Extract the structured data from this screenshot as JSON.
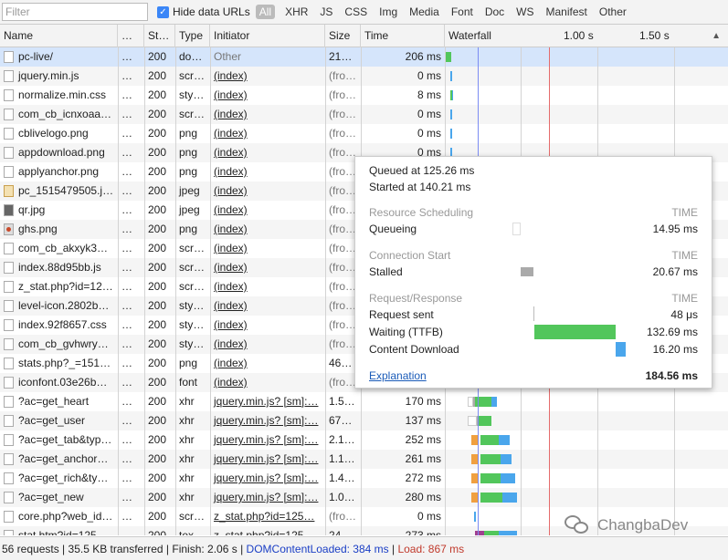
{
  "filter": {
    "placeholder": "Filter"
  },
  "hide_data_urls": {
    "label": "Hide data URLs",
    "checked": true
  },
  "type_filters": [
    "All",
    "XHR",
    "JS",
    "CSS",
    "Img",
    "Media",
    "Font",
    "Doc",
    "WS",
    "Manifest",
    "Other"
  ],
  "columns": {
    "name": "Name",
    "dots": "…",
    "status": "St…",
    "type": "Type",
    "initiator": "Initiator",
    "size": "Size",
    "time": "Time",
    "waterfall": "Waterfall"
  },
  "waterfall_ticks": [
    "1.00 s",
    "1.50 s"
  ],
  "rows": [
    {
      "name": "pc-live/",
      "dots": "…",
      "status": "200",
      "type": "do…",
      "initiator": "Other",
      "size": "21…",
      "time": "206 ms",
      "icon": "document-icon"
    },
    {
      "name": "jquery.min.js",
      "dots": "…",
      "status": "200",
      "type": "scr…",
      "initiator": "(index)",
      "size": "(fro…",
      "time": "0 ms",
      "icon": "document-icon"
    },
    {
      "name": "normalize.min.css",
      "dots": "…",
      "status": "200",
      "type": "sty…",
      "initiator": "(index)",
      "size": "(fro…",
      "time": "8 ms",
      "icon": "document-icon"
    },
    {
      "name": "com_cb_icnxoaa…",
      "dots": "…",
      "status": "200",
      "type": "scr…",
      "initiator": "(index)",
      "size": "(fro…",
      "time": "0 ms",
      "icon": "document-icon"
    },
    {
      "name": "cblivelogo.png",
      "dots": "…",
      "status": "200",
      "type": "png",
      "initiator": "(index)",
      "size": "(fro…",
      "time": "0 ms",
      "icon": "document-icon"
    },
    {
      "name": "appdownload.png",
      "dots": "…",
      "status": "200",
      "type": "png",
      "initiator": "(index)",
      "size": "(fro…",
      "time": "0 ms",
      "icon": "document-icon"
    },
    {
      "name": "applyanchor.png",
      "dots": "…",
      "status": "200",
      "type": "png",
      "initiator": "(index)",
      "size": "(fro…",
      "time": "",
      "icon": "document-icon"
    },
    {
      "name": "pc_1515479505.j…",
      "dots": "…",
      "status": "200",
      "type": "jpeg",
      "initiator": "(index)",
      "size": "(fro…",
      "time": "",
      "icon": "jpeg-icon"
    },
    {
      "name": "qr.jpg",
      "dots": "…",
      "status": "200",
      "type": "jpeg",
      "initiator": "(index)",
      "size": "(fro…",
      "time": "",
      "icon": "qr-image-icon"
    },
    {
      "name": "ghs.png",
      "dots": "…",
      "status": "200",
      "type": "png",
      "initiator": "(index)",
      "size": "(fro…",
      "time": "",
      "icon": "image-icon"
    },
    {
      "name": "com_cb_akxyk3…",
      "dots": "…",
      "status": "200",
      "type": "scr…",
      "initiator": "(index)",
      "size": "(fro…",
      "time": "",
      "icon": "document-icon"
    },
    {
      "name": "index.88d95bb.js",
      "dots": "…",
      "status": "200",
      "type": "scr…",
      "initiator": "(index)",
      "size": "(fro…",
      "time": "",
      "icon": "document-icon"
    },
    {
      "name": "z_stat.php?id=12…",
      "dots": "…",
      "status": "200",
      "type": "scr…",
      "initiator": "(index)",
      "size": "(fro…",
      "time": "",
      "icon": "document-icon"
    },
    {
      "name": "level-icon.2802b…",
      "dots": "…",
      "status": "200",
      "type": "sty…",
      "initiator": "(index)",
      "size": "(fro…",
      "time": "",
      "icon": "document-icon"
    },
    {
      "name": "index.92f8657.css",
      "dots": "…",
      "status": "200",
      "type": "sty…",
      "initiator": "(index)",
      "size": "(fro…",
      "time": "",
      "icon": "document-icon"
    },
    {
      "name": "com_cb_gvhwry…",
      "dots": "…",
      "status": "200",
      "type": "sty…",
      "initiator": "(index)",
      "size": "(fro…",
      "time": "",
      "icon": "document-icon"
    },
    {
      "name": "stats.php?_=151…",
      "dots": "…",
      "status": "200",
      "type": "png",
      "initiator": "(index)",
      "size": "46…",
      "time": "",
      "icon": "document-icon"
    },
    {
      "name": "iconfont.03e26b…",
      "dots": "…",
      "status": "200",
      "type": "font",
      "initiator": "(index)",
      "size": "(fro…",
      "time": "",
      "icon": "document-icon"
    },
    {
      "name": "?ac=get_heart",
      "dots": "…",
      "status": "200",
      "type": "xhr",
      "initiator": "jquery.min.js? [sm]:…",
      "size": "1.5…",
      "time": "170 ms",
      "icon": "document-icon"
    },
    {
      "name": "?ac=get_user",
      "dots": "…",
      "status": "200",
      "type": "xhr",
      "initiator": "jquery.min.js? [sm]:…",
      "size": "67…",
      "time": "137 ms",
      "icon": "document-icon"
    },
    {
      "name": "?ac=get_tab&typ…",
      "dots": "…",
      "status": "200",
      "type": "xhr",
      "initiator": "jquery.min.js? [sm]:…",
      "size": "2.1…",
      "time": "252 ms",
      "icon": "document-icon"
    },
    {
      "name": "?ac=get_anchor…",
      "dots": "…",
      "status": "200",
      "type": "xhr",
      "initiator": "jquery.min.js? [sm]:…",
      "size": "1.1…",
      "time": "261 ms",
      "icon": "document-icon"
    },
    {
      "name": "?ac=get_rich&ty…",
      "dots": "…",
      "status": "200",
      "type": "xhr",
      "initiator": "jquery.min.js? [sm]:…",
      "size": "1.4…",
      "time": "272 ms",
      "icon": "document-icon"
    },
    {
      "name": "?ac=get_new",
      "dots": "…",
      "status": "200",
      "type": "xhr",
      "initiator": "jquery.min.js? [sm]:…",
      "size": "1.0…",
      "time": "280 ms",
      "icon": "document-icon"
    },
    {
      "name": "core.php?web_id…",
      "dots": "…",
      "status": "200",
      "type": "scr…",
      "initiator": "z_stat.php?id=125…",
      "size": "(fro…",
      "time": "0 ms",
      "icon": "document-icon"
    },
    {
      "name": "stat.htm?id=125…",
      "dots": "…",
      "status": "200",
      "type": "tex…",
      "initiator": "z_stat.php?id=125…",
      "size": "24…",
      "time": "273 ms",
      "icon": "document-icon"
    }
  ],
  "tooltip": {
    "queued": "Queued at 125.26 ms",
    "started": "Started at 140.21 ms",
    "sections": [
      {
        "title": "Resource Scheduling",
        "time_label": "TIME",
        "items": [
          {
            "label": "Queueing",
            "value": "14.95 ms"
          }
        ]
      },
      {
        "title": "Connection Start",
        "time_label": "TIME",
        "items": [
          {
            "label": "Stalled",
            "value": "20.67 ms"
          }
        ]
      },
      {
        "title": "Request/Response",
        "time_label": "TIME",
        "items": [
          {
            "label": "Request sent",
            "value": "48 μs"
          },
          {
            "label": "Waiting (TTFB)",
            "value": "132.69 ms"
          },
          {
            "label": "Content Download",
            "value": "16.20 ms"
          }
        ]
      }
    ],
    "explanation": "Explanation",
    "total": "184.56 ms"
  },
  "status": {
    "requests": "56 requests",
    "transferred": "35.5 KB transferred",
    "finish": "Finish: 2.06 s",
    "dcl": "DOMContentLoaded: 384 ms",
    "load": "Load: 867 ms",
    "sep": " | "
  },
  "watermark": {
    "text": "ChangbaDev"
  },
  "colors": {
    "waiting": "#52c65b",
    "download": "#4aa6ec",
    "stalled": "#aaaaaa",
    "queue": "#ffffff",
    "dcl": "#7c8cf3",
    "load": "#e46b6b",
    "selected": "#d5e5fb"
  }
}
